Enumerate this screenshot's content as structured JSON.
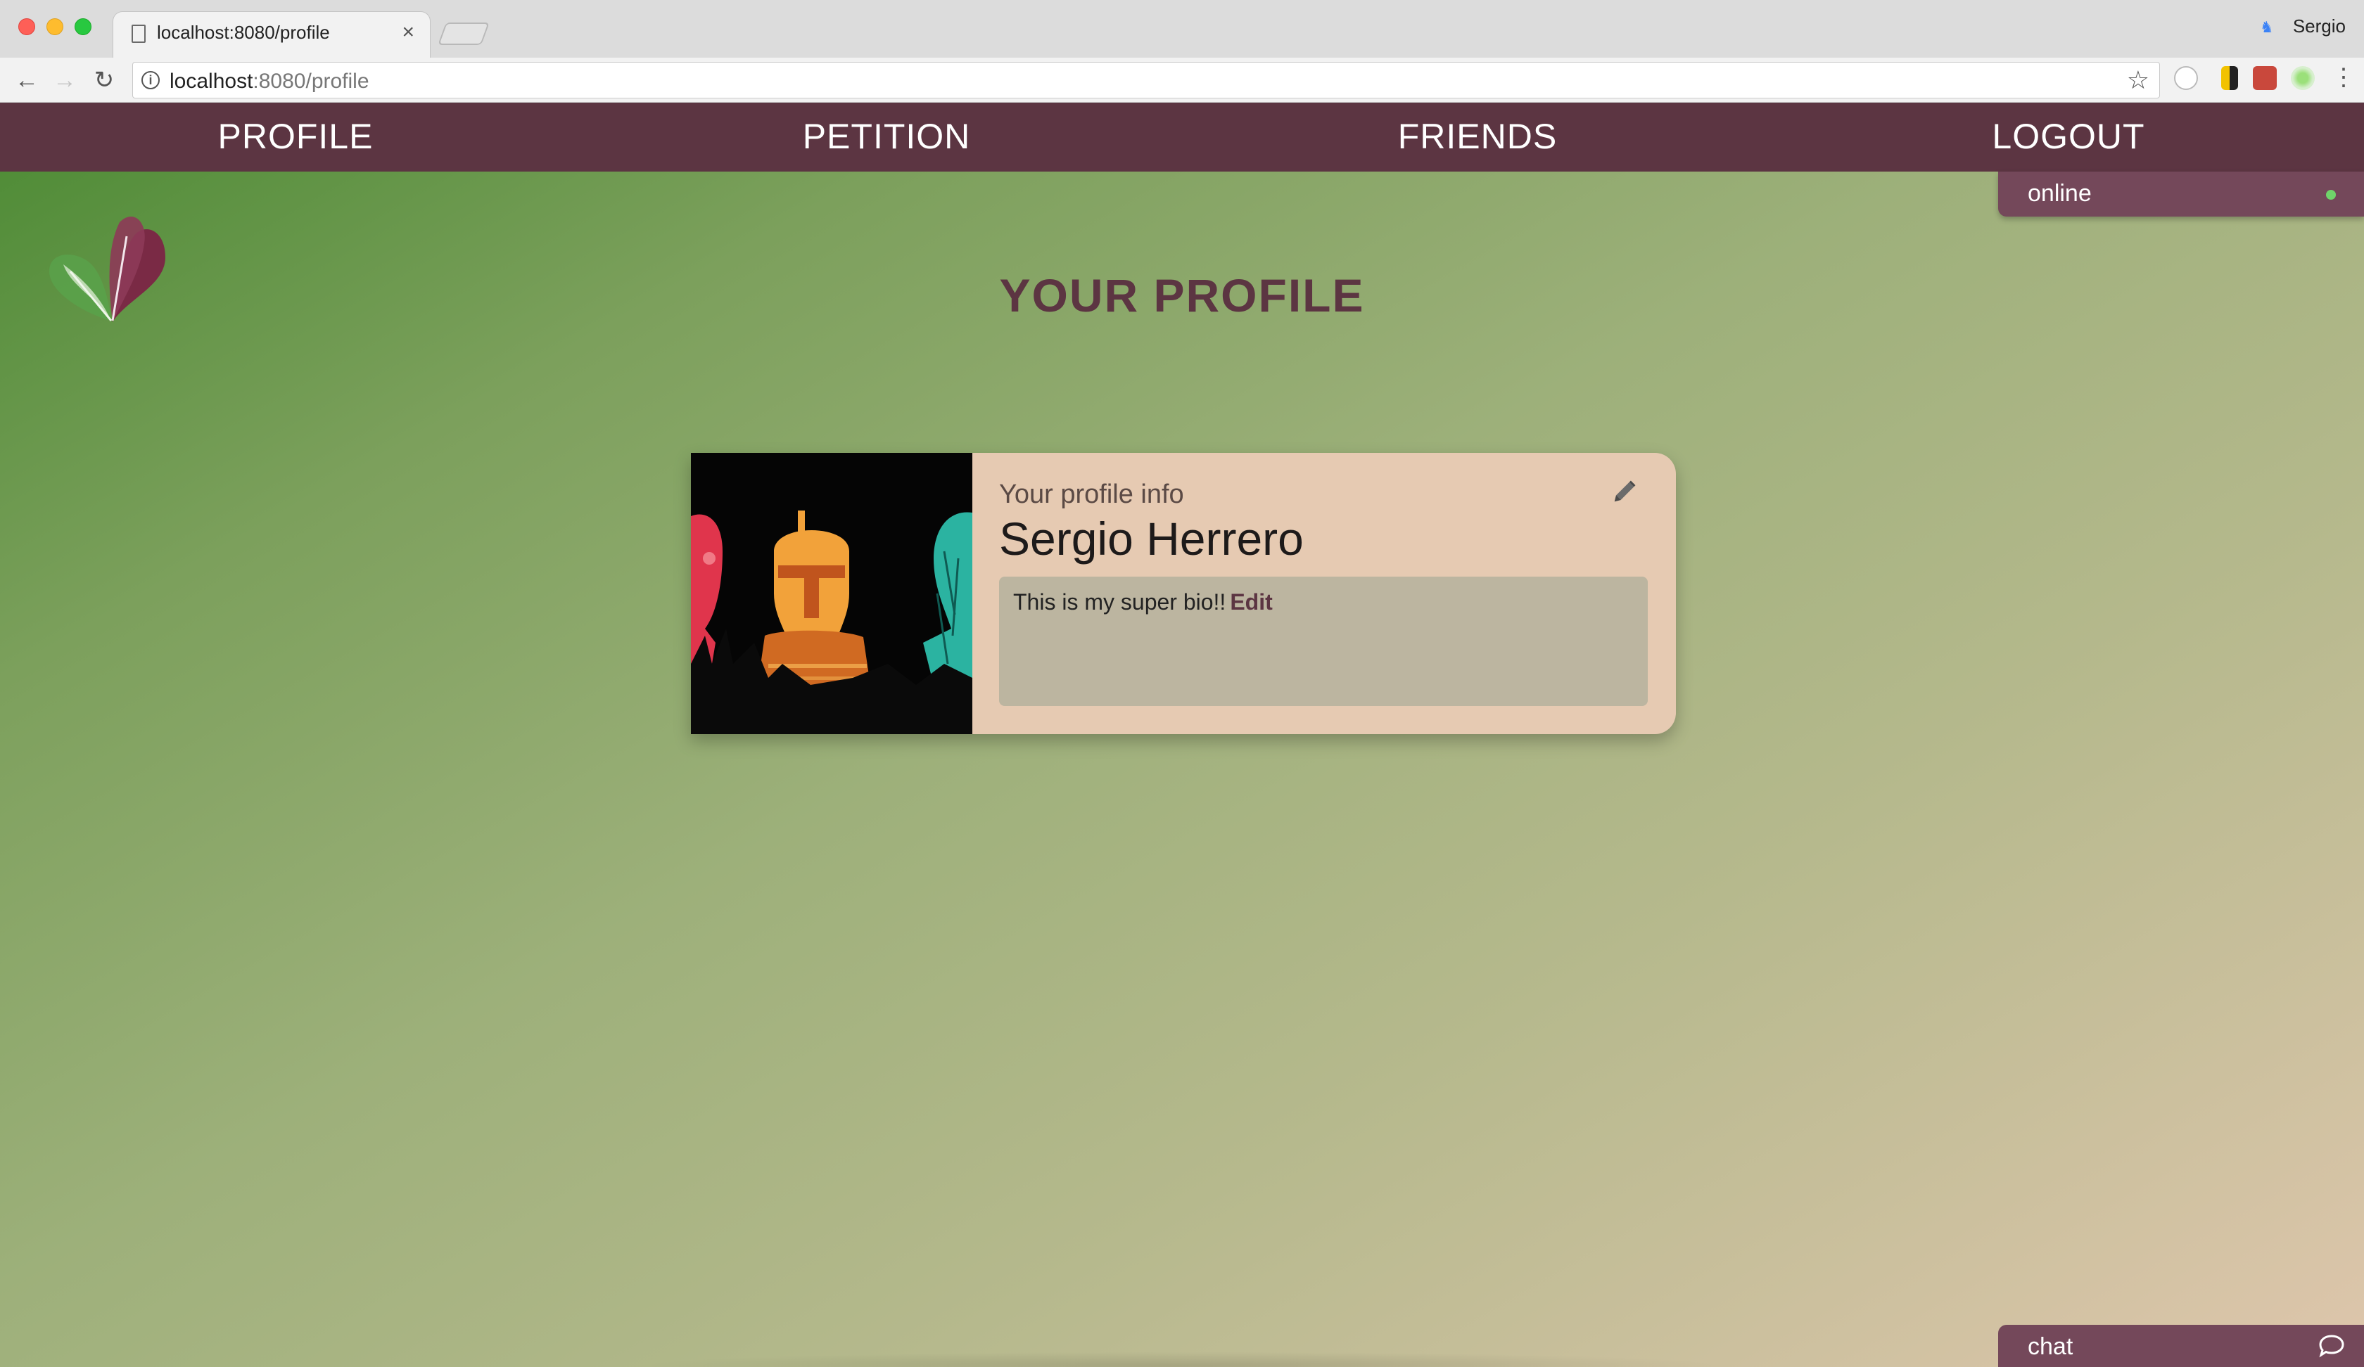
{
  "browser": {
    "tab_title": "localhost:8080/profile",
    "tab_close": "×",
    "profile_name": "Sergio",
    "url_host": "localhost",
    "url_path": ":8080/profile"
  },
  "nav": {
    "items": [
      {
        "label": "PROFILE"
      },
      {
        "label": "PETITION"
      },
      {
        "label": "FRIENDS"
      },
      {
        "label": "LOGOUT"
      }
    ]
  },
  "page": {
    "title": "YOUR PROFILE"
  },
  "profile": {
    "subtitle": "Your profile info",
    "name": "Sergio Herrero",
    "bio": "This is my super bio!!",
    "edit_label": "Edit"
  },
  "online": {
    "label": "online",
    "status_color": "#6fd46a"
  },
  "chat": {
    "label": "chat"
  },
  "colors": {
    "nav_bg": "#5c3542",
    "accent": "#5c3542",
    "card_bg": "#e6cab2",
    "panel_bg": "#74485a"
  }
}
